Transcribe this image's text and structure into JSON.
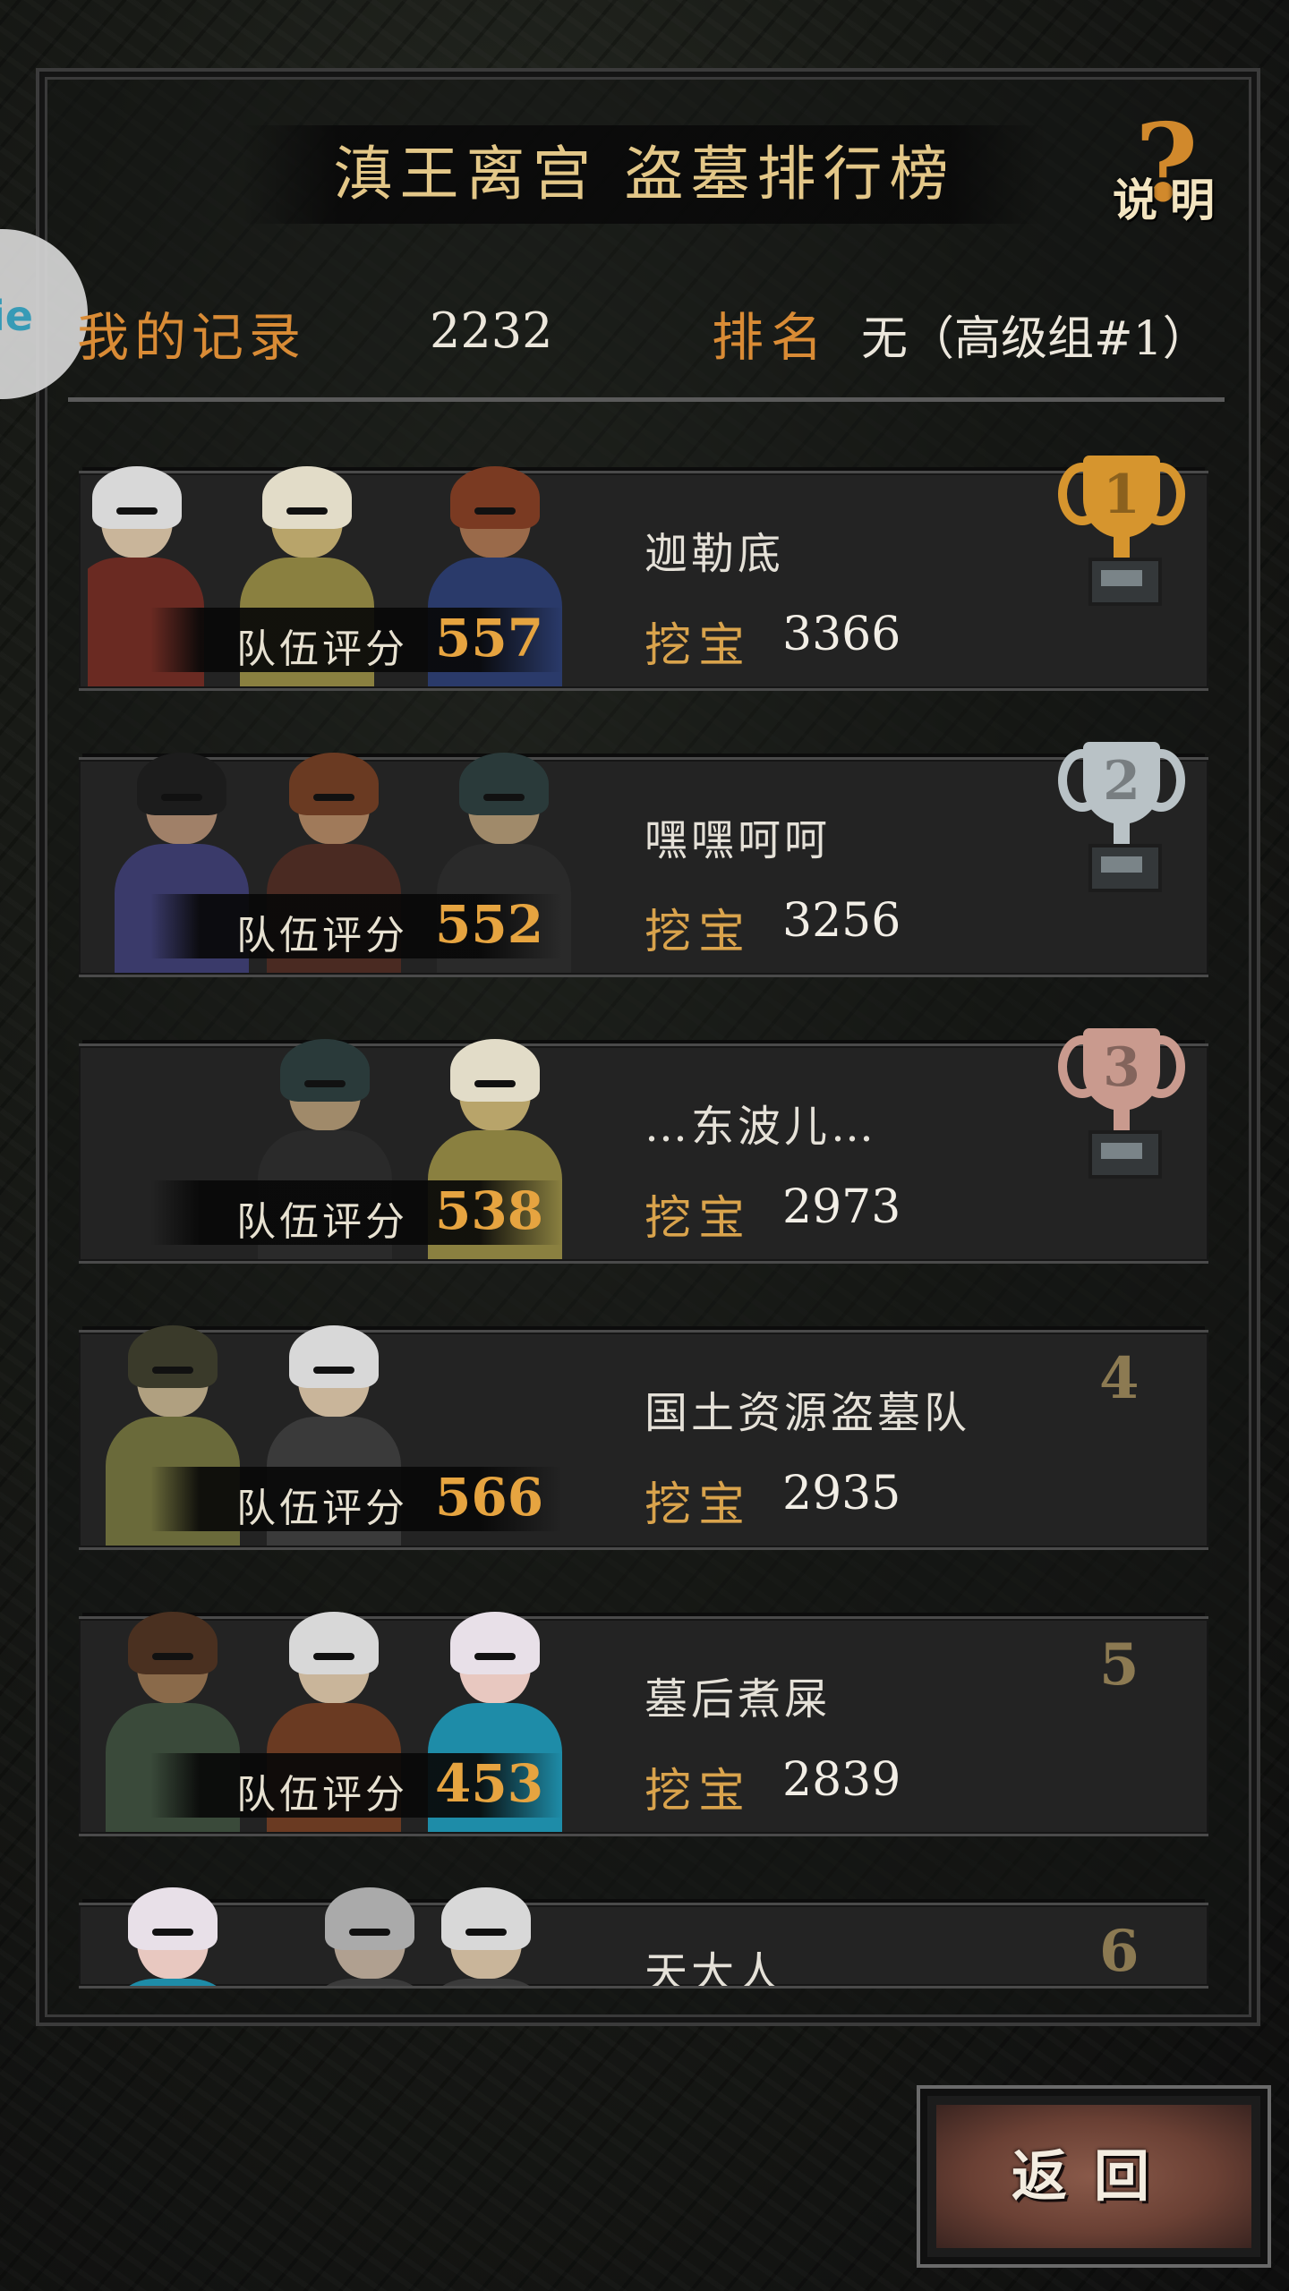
{
  "header": {
    "title": "滇王离宫 盗墓排行榜",
    "help_label": "说明",
    "help_glyph": "?"
  },
  "side_tab": {
    "text": "ie"
  },
  "record": {
    "label": "我的记录",
    "value": "2232",
    "rank_label": "排名",
    "rank_value": "无（高级组#1）"
  },
  "leaderboard": {
    "team_score_label": "队伍评分",
    "dig_label": "挖宝",
    "rows": [
      {
        "rank": "1",
        "name": "迦勒底",
        "team_score": "557",
        "dig_score": "3366",
        "trophy": "gold"
      },
      {
        "rank": "2",
        "name": "嘿嘿呵呵",
        "team_score": "552",
        "dig_score": "3256",
        "trophy": "silver"
      },
      {
        "rank": "3",
        "name": "…东波儿…",
        "team_score": "538",
        "dig_score": "2973",
        "trophy": "bronze"
      },
      {
        "rank": "4",
        "name": "国土资源盗墓队",
        "team_score": "566",
        "dig_score": "2935",
        "trophy": ""
      },
      {
        "rank": "5",
        "name": "墓后煮屎",
        "team_score": "453",
        "dig_score": "2839",
        "trophy": ""
      },
      {
        "rank": "6",
        "name": "天大人",
        "team_score": "",
        "dig_score": "",
        "trophy": ""
      }
    ]
  },
  "back_button": {
    "label": "返回"
  },
  "colors": {
    "gold_trophy": "#d6952e",
    "silver_trophy": "#b9c2c6",
    "bronze_trophy": "#c99a8e",
    "accent_orange": "#d98b35"
  }
}
